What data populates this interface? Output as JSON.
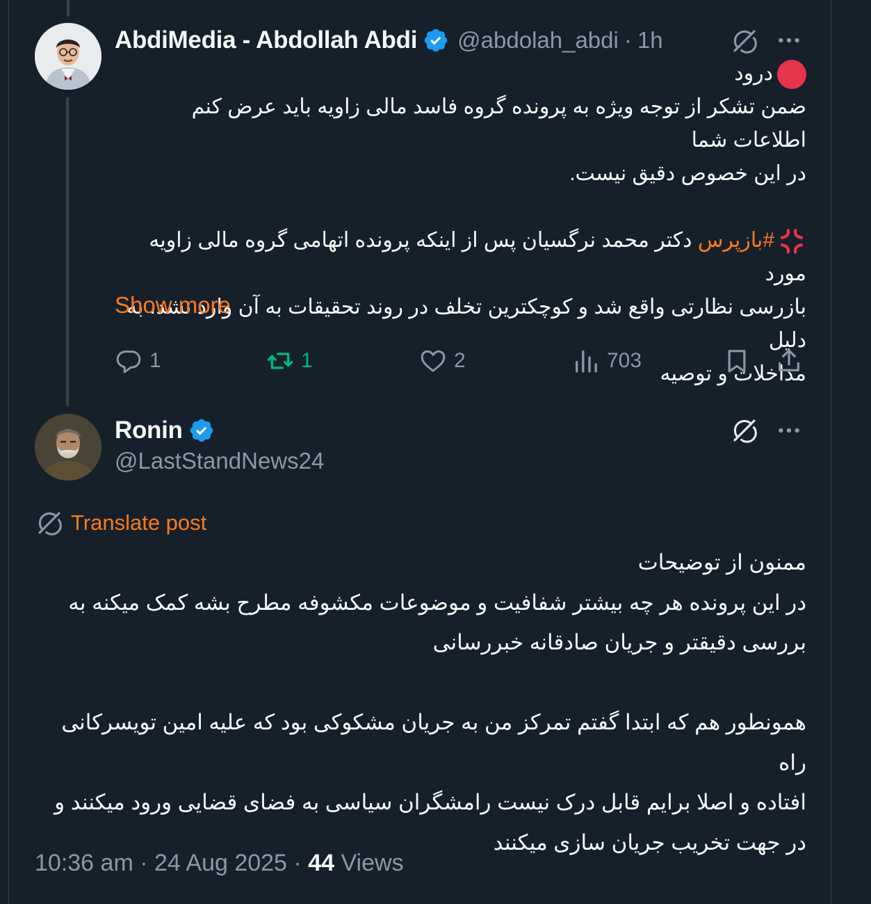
{
  "thread": {
    "parent": {
      "author_name": "AbdiMedia - Abdollah Abdi",
      "handle": "@abdolah_abdi",
      "separator": "·",
      "time": "1h",
      "body_lines": [
        "درود",
        "ضمن تشکر از توجه ویژه به پرونده گروه فاسد مالی زاویه باید عرض کنم اطلاعات شما",
        "در این خصوص دقیق نیست.",
        "",
        "#بازپرس",
        "دکتر محمد نرگسیان پس از اینکه پرونده اتهامی گروه مالی زاویه مورد",
        "بازرسی نظارتی واقع شد و کوچکترین تخلف در روند تحقیقات به آن وارد نشد، به دلیل",
        "مداخلات و توصیه"
      ],
      "show_more_label": "Show more",
      "counts": {
        "replies": "1",
        "reposts": "1",
        "likes": "2",
        "views": "703"
      },
      "icons": [
        "grok-icon",
        "more-icon",
        "red-circle-emoji",
        "anger-symbol-emoji",
        "reply-icon",
        "repost-icon",
        "like-icon",
        "views-icon",
        "bookmark-icon",
        "share-icon"
      ]
    },
    "reply": {
      "author_name": "Ronin",
      "handle": "@LastStandNews24",
      "translate_label": "Translate post",
      "body_lines": [
        "ممنون از توضیحات",
        "در این پرونده هر چه بیشتر شفافیت و موضوعات مکشوفه مطرح بشه کمک میکنه به",
        "بررسی دقیقتر و جریان صادقانه خبررسانی",
        "",
        "همونطور هم که ابتدا گفتم تمرکز من به جریان مشکوکی بود که علیه امین تویسرکانی راه",
        "افتاده و اصلا برایم قابل درک نیست رامشگران سیاسی به فضای قضایی ورود میکنند و",
        "در جهت تخریب جریان سازی میکنند"
      ],
      "footer": {
        "time": "10:36 am",
        "sep1": "·",
        "date": "24 Aug 2025",
        "sep2": "·",
        "views_count": "44",
        "views_label": "Views"
      }
    }
  },
  "colors": {
    "background": "#15202b",
    "text": "#f7f9f9",
    "secondary": "#8b98a5",
    "accent": "#ff7a1a",
    "repost_active": "#00ba7c",
    "verified": "#1d9bf0"
  }
}
